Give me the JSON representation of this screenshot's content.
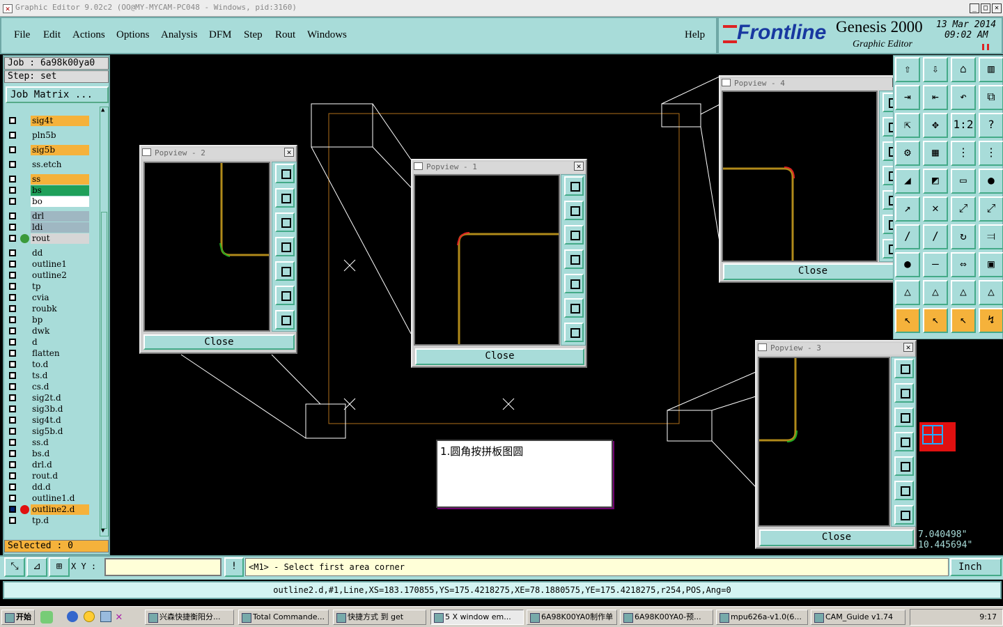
{
  "window": {
    "title": "Graphic Editor 9.02c2  (OO@MY-MYCAM-PC048 - Windows, pid:3160)"
  },
  "menu": {
    "items": [
      "File",
      "Edit",
      "Actions",
      "Options",
      "Analysis",
      "DFM",
      "Step",
      "Rout",
      "Windows"
    ],
    "help": "Help"
  },
  "brand": {
    "logo": "Frontline",
    "product": "Genesis 2000",
    "subtitle": "Graphic Editor",
    "date": "13 Mar 2014",
    "time": "09:02 AM"
  },
  "job": {
    "job_line": "Job : 6a98k00ya0",
    "step_line": "Step: set",
    "matrix_button": "Job Matrix ..."
  },
  "layers": [
    {
      "name": "sig4t",
      "color": "#f5b23b",
      "marker": ""
    },
    {
      "name": "pln5b",
      "color": "#a8dcd9",
      "marker": ""
    },
    {
      "name": "sig5b",
      "color": "#f5b23b",
      "marker": ""
    },
    {
      "name": "ss.etch",
      "color": "#a8dcd9",
      "marker": ""
    },
    {
      "name": "ss",
      "color": "#f5b23b",
      "marker": ""
    },
    {
      "name": "bs",
      "color": "#1fa05a",
      "marker": ""
    },
    {
      "name": "bo",
      "color": "#ffffff",
      "marker": ""
    },
    {
      "name": "drl",
      "color": "#9fb7c2",
      "marker": ""
    },
    {
      "name": "ldi",
      "color": "#9fb7c2",
      "marker": ""
    },
    {
      "name": "rout",
      "color": "#d6d6d6",
      "marker": "green"
    },
    {
      "name": "dd",
      "color": "#a8dcd9",
      "marker": ""
    },
    {
      "name": "outline1",
      "color": "#a8dcd9",
      "marker": ""
    },
    {
      "name": "outline2",
      "color": "#a8dcd9",
      "marker": ""
    },
    {
      "name": "tp",
      "color": "#a8dcd9",
      "marker": ""
    },
    {
      "name": "cvia",
      "color": "#a8dcd9",
      "marker": ""
    },
    {
      "name": "roubk",
      "color": "#a8dcd9",
      "marker": ""
    },
    {
      "name": "bp",
      "color": "#a8dcd9",
      "marker": ""
    },
    {
      "name": "dwk",
      "color": "#a8dcd9",
      "marker": ""
    },
    {
      "name": "d",
      "color": "#a8dcd9",
      "marker": ""
    },
    {
      "name": "flatten",
      "color": "#a8dcd9",
      "marker": ""
    },
    {
      "name": "to.d",
      "color": "#a8dcd9",
      "marker": ""
    },
    {
      "name": "ts.d",
      "color": "#a8dcd9",
      "marker": ""
    },
    {
      "name": "cs.d",
      "color": "#a8dcd9",
      "marker": ""
    },
    {
      "name": "sig2t.d",
      "color": "#a8dcd9",
      "marker": ""
    },
    {
      "name": "sig3b.d",
      "color": "#a8dcd9",
      "marker": ""
    },
    {
      "name": "sig4t.d",
      "color": "#a8dcd9",
      "marker": ""
    },
    {
      "name": "sig5b.d",
      "color": "#a8dcd9",
      "marker": ""
    },
    {
      "name": "ss.d",
      "color": "#a8dcd9",
      "marker": ""
    },
    {
      "name": "bs.d",
      "color": "#a8dcd9",
      "marker": ""
    },
    {
      "name": "drl.d",
      "color": "#a8dcd9",
      "marker": ""
    },
    {
      "name": "rout.d",
      "color": "#a8dcd9",
      "marker": ""
    },
    {
      "name": "dd.d",
      "color": "#a8dcd9",
      "marker": ""
    },
    {
      "name": "outline1.d",
      "color": "#a8dcd9",
      "marker": ""
    },
    {
      "name": "outline2.d",
      "color": "#f5b23b",
      "marker": "red"
    },
    {
      "name": "tp.d",
      "color": "#a8dcd9",
      "marker": ""
    }
  ],
  "selected": "Selected : 0",
  "popviews": {
    "p1": "Popview - 1",
    "p2": "Popview - 2",
    "p3": "Popview - 3",
    "p4": "Popview - 4",
    "close": "Close"
  },
  "note": "1.圆角按拼板图圆",
  "coords": {
    "x": "7.040498\"",
    "y": "10.445694\""
  },
  "status": {
    "xy_label": "X Y :",
    "prompt": "<M1> - Select first area corner",
    "units": "Inch"
  },
  "info_line": "outline2.d,#1,Line,XS=183.170855,YS=175.4218275,XE=78.1880575,YE=175.4218275,r254,POS,Ang=0",
  "taskbar": {
    "start": "开始",
    "items": [
      "兴森快捷衡阳分...",
      "Total Commande...",
      "快捷方式 到 get",
      "5 X window em...",
      "6A98K00YA0制作单",
      "6A98K00YA0-预...",
      "mpu626a-v1.0(6...",
      "CAM_Guide v1.74"
    ],
    "clock": "9:17"
  },
  "colors": {
    "panel": "#a8dcd9",
    "highlight": "#f5b23b",
    "trace": "#b08a1a"
  }
}
